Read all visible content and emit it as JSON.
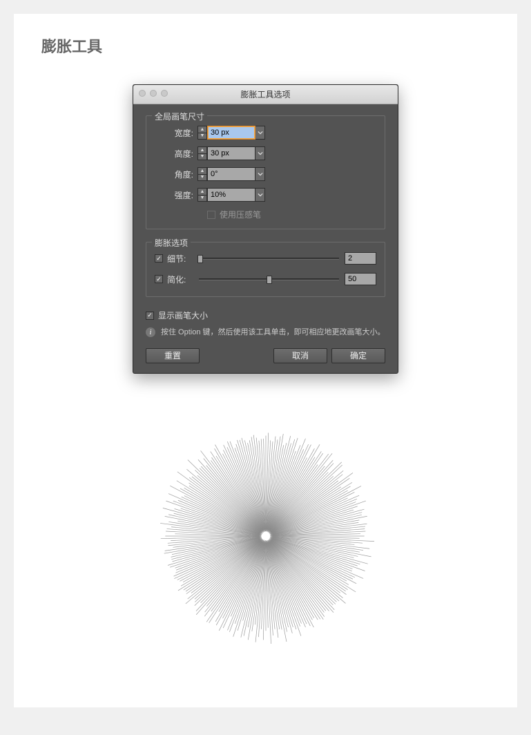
{
  "page": {
    "heading": "膨胀工具"
  },
  "dialog": {
    "title": "膨胀工具选项",
    "brush_section": {
      "legend": "全局画笔尺寸",
      "width": {
        "label": "宽度:",
        "value": "30 px"
      },
      "height": {
        "label": "高度:",
        "value": "30 px"
      },
      "angle": {
        "label": "角度:",
        "value": "0°"
      },
      "intensity": {
        "label": "强度:",
        "value": "10%"
      },
      "pressure_pen": {
        "label": "使用压感笔",
        "checked": false,
        "enabled": false
      }
    },
    "bloat_section": {
      "legend": "膨胀选项",
      "detail": {
        "label": "细节:",
        "checked": true,
        "value": "2",
        "slider_percent": 1
      },
      "simplify": {
        "label": "简化:",
        "checked": true,
        "value": "50",
        "slider_percent": 50
      }
    },
    "show_brush_size": {
      "label": "显示画笔大小",
      "checked": true
    },
    "info_text": "按住 Option 键，然后使用该工具单击，即可相应地更改画笔大小。",
    "buttons": {
      "reset": "重置",
      "cancel": "取消",
      "ok": "确定"
    }
  }
}
